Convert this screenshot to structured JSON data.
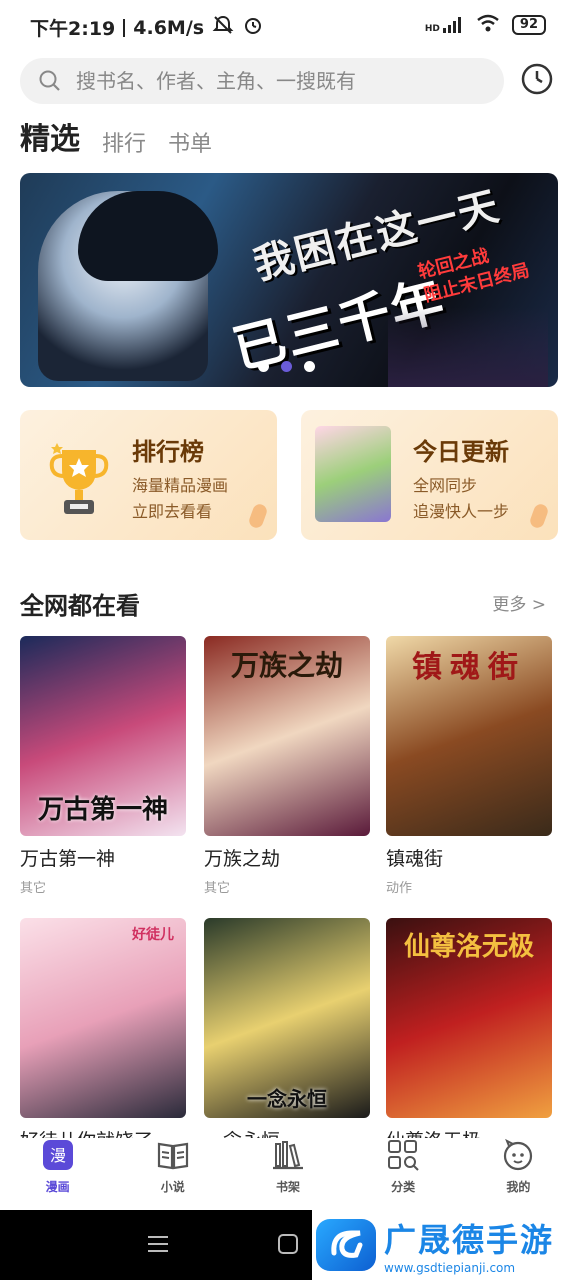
{
  "status_bar": {
    "time": "下午2:19",
    "speed": "4.6M/s",
    "battery": "92",
    "signal_label": "HD"
  },
  "search": {
    "placeholder": "搜书名、作者、主角、一搜既有"
  },
  "tabs": [
    {
      "label": "精选",
      "active": true
    },
    {
      "label": "排行",
      "active": false
    },
    {
      "label": "书单",
      "active": false
    }
  ],
  "banner": {
    "headline_1": "我困在这一天",
    "headline_2": "已三千年",
    "tagline_1": "轮回之战",
    "tagline_2": "阻止末日终局",
    "dot_count": 3,
    "active_dot": 2
  },
  "cards": [
    {
      "title": "排行榜",
      "line1": "海量精品漫画",
      "line2": "立即去看看"
    },
    {
      "title": "今日更新",
      "line1": "全网同步",
      "line2": "追漫快人一步"
    }
  ],
  "section": {
    "title": "全网都在看",
    "more": "更多 >"
  },
  "books": [
    {
      "name": "万古第一神",
      "genre": "其它",
      "cover_text": "万古第一神",
      "colors": [
        "#1b2a5a",
        "#c84a7a",
        "#f3e3f0"
      ]
    },
    {
      "name": "万族之劫",
      "genre": "其它",
      "cover_text": "万族之劫",
      "colors": [
        "#8a2a22",
        "#f0d7c0",
        "#5a1a3a"
      ]
    },
    {
      "name": "镇魂街",
      "genre": "动作",
      "cover_text": "镇魂街",
      "colors": [
        "#f0d9a8",
        "#8a4a22",
        "#3a2a1a"
      ]
    },
    {
      "name": "好徒儿你就饶了",
      "genre": "",
      "cover_text": "好徒儿",
      "colors": [
        "#fbe0e8",
        "#e8a0b8",
        "#2a2a3a"
      ]
    },
    {
      "name": "一念永恒",
      "genre": "",
      "cover_text": "一念永恒",
      "colors": [
        "#2a3a2a",
        "#e8d070",
        "#1a1a1a"
      ]
    },
    {
      "name": "仙尊洛无极",
      "genre": "",
      "cover_text": "仙尊洛无极",
      "colors": [
        "#3a1010",
        "#c02020",
        "#f0a040"
      ]
    }
  ],
  "bottom_nav": [
    {
      "label": "漫画",
      "icon": "comic-icon",
      "active": true
    },
    {
      "label": "小说",
      "icon": "book-icon",
      "active": false
    },
    {
      "label": "书架",
      "icon": "bookshelf-icon",
      "active": false
    },
    {
      "label": "分类",
      "icon": "category-icon",
      "active": false
    },
    {
      "label": "我的",
      "icon": "profile-icon",
      "active": false
    }
  ],
  "watermark": {
    "name": "广晟德手游",
    "url": "www.gsdtiepianji.com"
  },
  "colors": {
    "accent": "#5b4ad8",
    "card_bg": "#fbe1bb",
    "card_title": "#6a3a08"
  }
}
